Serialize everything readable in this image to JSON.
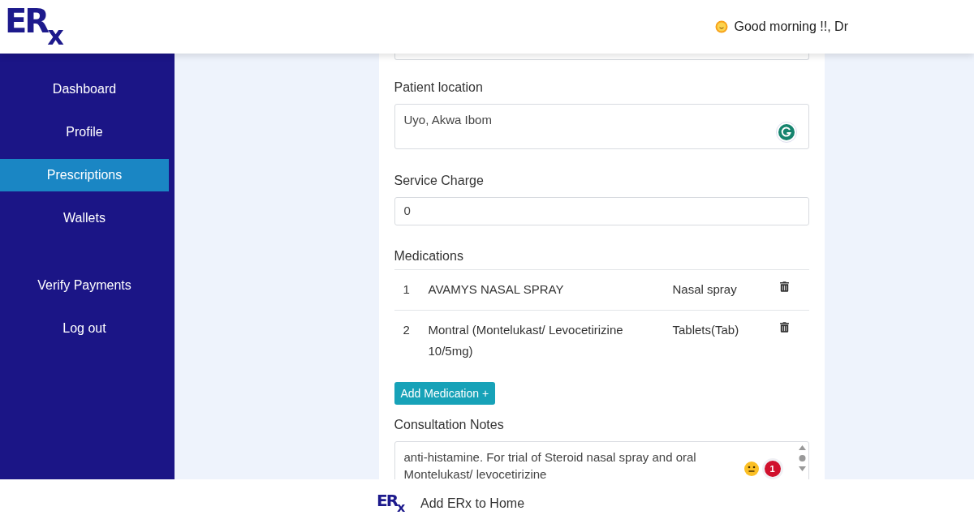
{
  "header": {
    "logo": {
      "letters": "ER",
      "sub_letter": "x"
    },
    "greeting": "Good morning !!, Dr"
  },
  "sidebar": {
    "items": [
      {
        "label": "Dashboard",
        "selected": false
      },
      {
        "label": "Profile",
        "selected": false
      },
      {
        "label": "Prescriptions",
        "selected": true
      },
      {
        "label": "Wallets",
        "selected": false
      },
      {
        "label": "Verify Payments",
        "selected": false
      },
      {
        "label": "Log out",
        "selected": false
      }
    ]
  },
  "form": {
    "location": {
      "label": "Patient location",
      "value": "Uyo, Akwa Ibom"
    },
    "service_charge": {
      "label": "Service Charge",
      "value": "0"
    },
    "medications": {
      "label": "Medications",
      "rows": [
        {
          "index": "1",
          "name": "AVAMYS NASAL SPRAY",
          "form": "Nasal spray"
        },
        {
          "index": "2",
          "name": "Montral (Montelukast/ Levocetirizine 10/5mg)",
          "form": "Tablets(Tab)"
        }
      ],
      "add_button": "Add Medication +"
    },
    "notes": {
      "label": "Consultation Notes",
      "value": "anti-histamine. For trial of Steroid nasal spray and oral Montelukast/ levocetirizine",
      "badge": "1"
    }
  },
  "install_bar": {
    "logo": {
      "letters": "ER",
      "sub_letter": "x"
    },
    "text": "Add ERx to Home"
  }
}
